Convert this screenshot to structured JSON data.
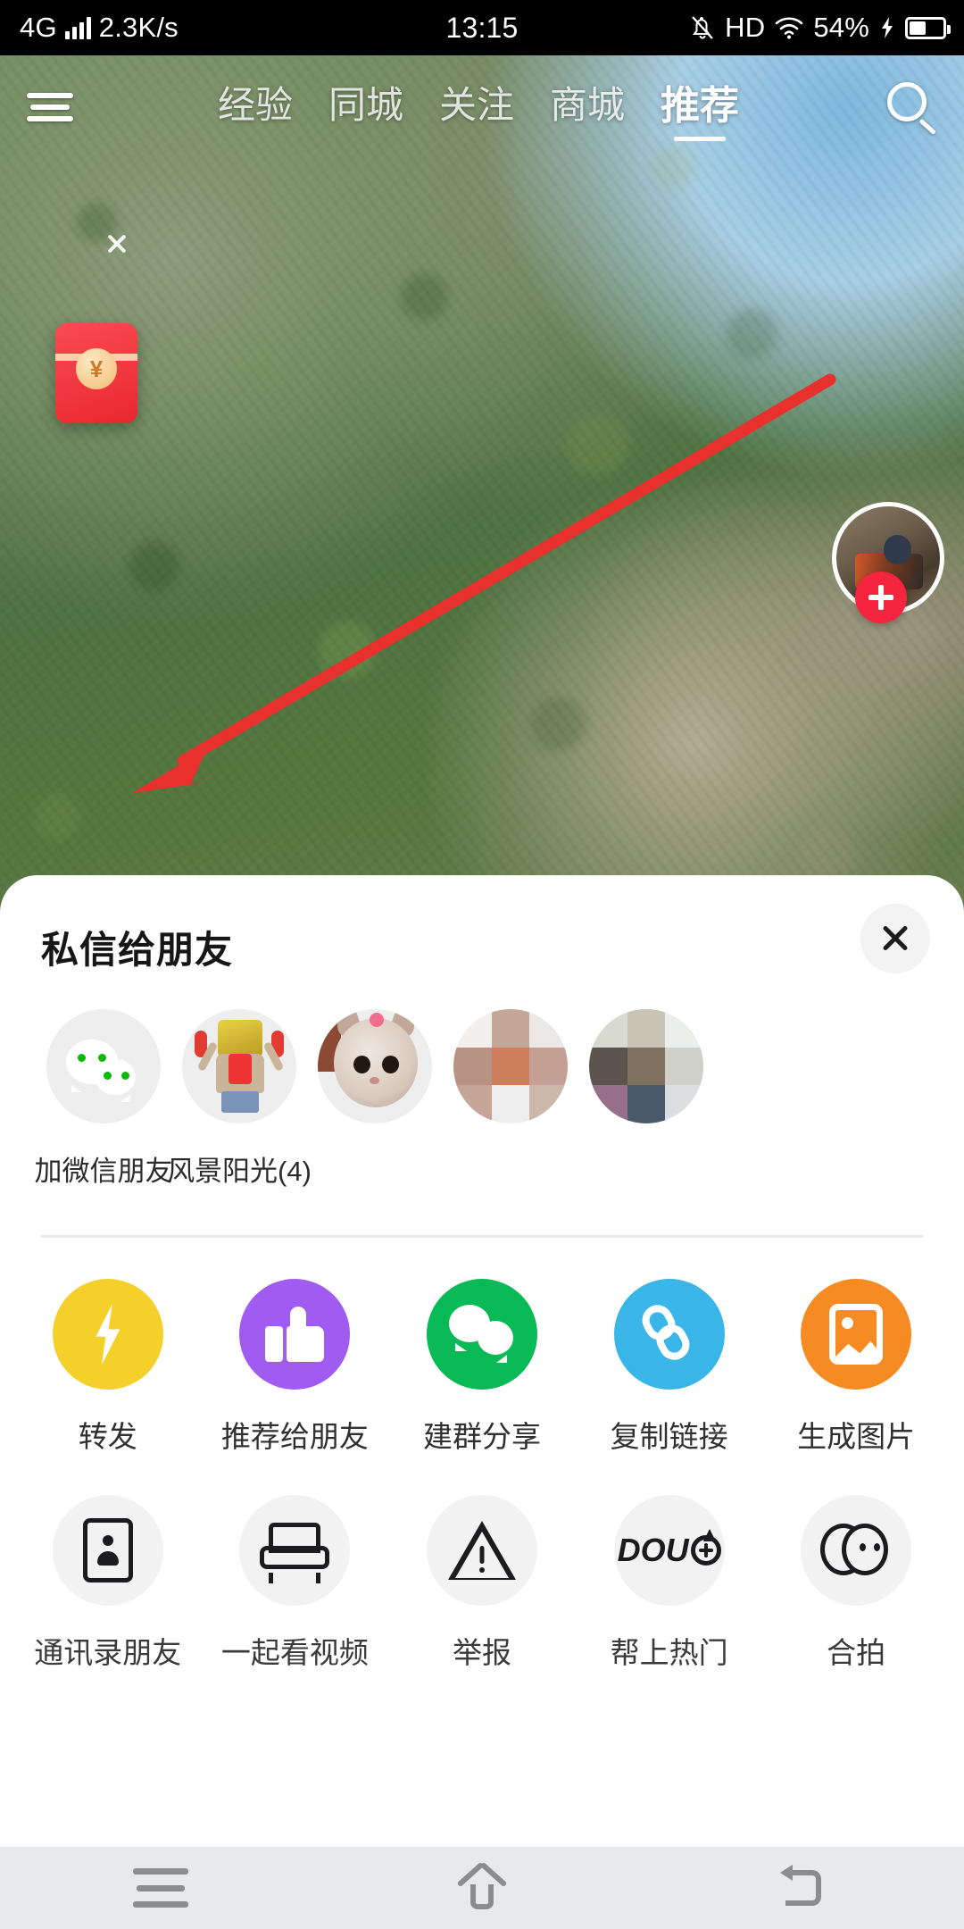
{
  "status_bar": {
    "network_type": "4G",
    "network_speed": "2.3K/s",
    "time": "13:15",
    "hd_label": "HD",
    "battery_percent": "54%",
    "icons": [
      "signal-bars-icon",
      "mute-bell-icon",
      "wifi-icon",
      "charging-bolt-icon",
      "battery-icon"
    ]
  },
  "top_nav": {
    "menu_icon": "hamburger-menu-icon",
    "search_icon": "search-icon",
    "tabs": [
      {
        "label": "经验",
        "active": false
      },
      {
        "label": "同城",
        "active": false
      },
      {
        "label": "关注",
        "active": false
      },
      {
        "label": "商城",
        "active": false
      },
      {
        "label": "推荐",
        "active": true
      }
    ]
  },
  "video_overlay": {
    "red_packet": {
      "icon": "red-envelope-icon",
      "currency_symbol": "¥"
    },
    "red_packet_close": "close-icon",
    "author_avatar": "author-avatar",
    "follow_button": "follow-plus-icon",
    "like_button": "heart-icon"
  },
  "share_sheet": {
    "title": "私信给朋友",
    "close_icon": "close-icon",
    "friends": [
      {
        "label": "加微信朋友",
        "avatar": "wechat-logo-icon",
        "type": "wechat"
      },
      {
        "label": "风景阳光(4)",
        "avatar": "group-avatar-doll",
        "type": "group"
      },
      {
        "label": "",
        "avatar": "friend-avatar-cat",
        "type": "friend"
      },
      {
        "label": "",
        "avatar": "friend-avatar-blurred",
        "type": "friend"
      },
      {
        "label": "",
        "avatar": "friend-avatar-blurred",
        "type": "friend"
      }
    ],
    "actions_row1": [
      {
        "label": "转发",
        "icon": "lightning-bolt-icon",
        "color": "#f5cf2a"
      },
      {
        "label": "推荐给朋友",
        "icon": "thumbs-up-icon",
        "color": "#a05cf0"
      },
      {
        "label": "建群分享",
        "icon": "group-chat-icon",
        "color": "#09b955"
      },
      {
        "label": "复制链接",
        "icon": "link-chain-icon",
        "color": "#3ab5e8"
      },
      {
        "label": "生成图片",
        "icon": "image-picture-icon",
        "color": "#f68a23"
      }
    ],
    "actions_row2": [
      {
        "label": "通讯录朋友",
        "icon": "contacts-card-icon"
      },
      {
        "label": "一起看视频",
        "icon": "sofa-watch-together-icon"
      },
      {
        "label": "举报",
        "icon": "warning-triangle-icon"
      },
      {
        "label": "帮上热门",
        "icon": "dou-plus-icon",
        "text": "DOU"
      },
      {
        "label": "合拍",
        "icon": "duet-circles-icon"
      }
    ]
  },
  "android_nav": {
    "recents_icon": "menu-recents-icon",
    "home_icon": "home-icon",
    "back_icon": "back-arrow-icon"
  },
  "annotation": {
    "arrow_color": "#e8302c",
    "points_to": "加微信朋友"
  }
}
